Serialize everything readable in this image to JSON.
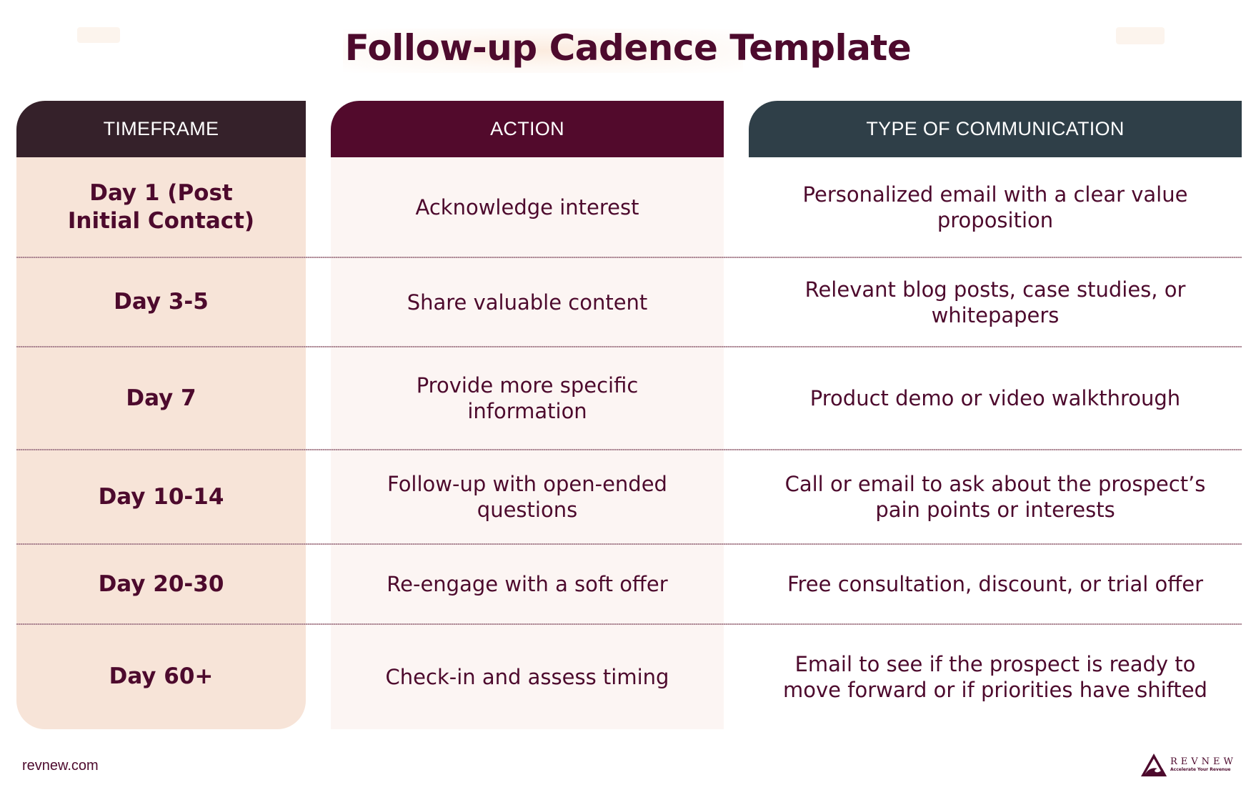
{
  "title": "Follow-up Cadence Template",
  "headers": {
    "timeframe": "TIMEFRAME",
    "action": "ACTION",
    "communication": "TYPE OF COMMUNICATION"
  },
  "rows": [
    {
      "timeframe": "Day 1 (Post Initial Contact)",
      "action": "Acknowledge interest",
      "communication": "Personalized email with a clear value proposition"
    },
    {
      "timeframe": "Day 3-5",
      "action": "Share valuable content",
      "communication": "Relevant blog posts, case studies, or whitepapers"
    },
    {
      "timeframe": "Day 7",
      "action": "Provide more specific information",
      "communication": "Product demo or video walkthrough"
    },
    {
      "timeframe": "Day 10-14",
      "action": "Follow-up with open-ended questions",
      "communication": "Call or email to ask about the prospect’s pain points or interests"
    },
    {
      "timeframe": "Day 20-30",
      "action": "Re-engage with a soft offer",
      "communication": "Free consultation, discount, or trial offer"
    },
    {
      "timeframe": "Day 60+",
      "action": "Check-in and assess timing",
      "communication": "Email to see if the prospect is ready to move forward or if priorities have shifted"
    }
  ],
  "footer": {
    "url": "revnew.com",
    "logo_name": "REVNEW",
    "logo_tagline": "Accelerate Your Revenue",
    "logo_icon": "mountain-wave-triangle-icon"
  },
  "colors": {
    "title": "#4d0a2d",
    "timeframe_header": "#35212a",
    "action_header": "#520a2c",
    "communication_header": "#2f3f48",
    "timeframe_bg": "#f7e4d8",
    "action_bg": "#fcf5f3"
  }
}
